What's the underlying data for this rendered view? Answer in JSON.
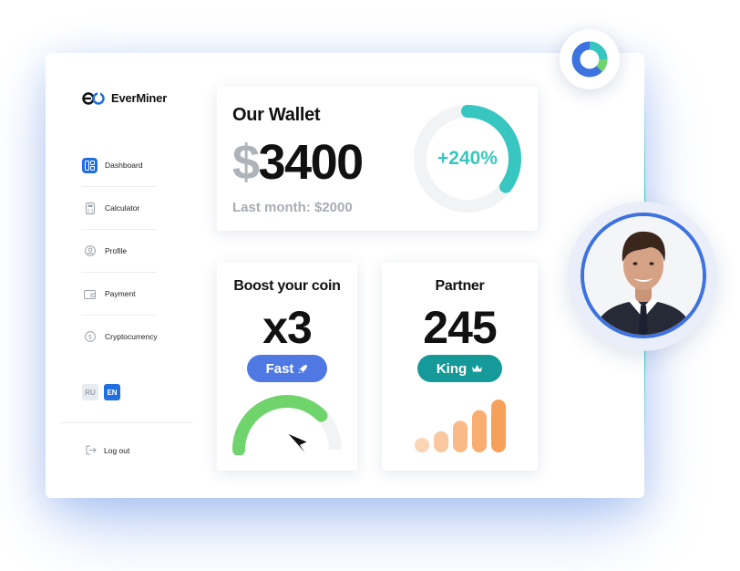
{
  "brand": {
    "name": "EverMiner"
  },
  "sidebar": {
    "items": [
      {
        "label": "Dashboard",
        "icon": "dashboard-icon",
        "active": true
      },
      {
        "label": "Calculator",
        "icon": "calculator-icon",
        "active": false
      },
      {
        "label": "Profile",
        "icon": "profile-icon",
        "active": false
      },
      {
        "label": "Payment",
        "icon": "wallet-icon",
        "active": false
      },
      {
        "label": "Cryptocurrency",
        "icon": "coin-icon",
        "active": false
      }
    ],
    "languages": [
      {
        "label": "RU",
        "active": false
      },
      {
        "label": "EN",
        "active": true
      }
    ],
    "logout_label": "Log out"
  },
  "wallet": {
    "title": "Our Wallet",
    "currency": "$",
    "amount": "3400",
    "last_month": "Last month: $2000",
    "growth": "+240%",
    "ring_fill": 0.35
  },
  "boost": {
    "title": "Boost your coin",
    "multiplier": "x3",
    "badge": "Fast",
    "badge_icon": "rocket-icon",
    "gauge_level": 0.75
  },
  "partner": {
    "title": "Partner",
    "count": "245",
    "badge": "King",
    "badge_icon": "crown-icon",
    "signal_levels": [
      1,
      2,
      3,
      4,
      5
    ]
  },
  "colors": {
    "primary": "#1f6fe0",
    "teal": "#38c6c0",
    "fast_badge": "#4f78e2",
    "king_badge": "#159a99",
    "gauge_green": "#6fd46c",
    "bar_orange": "#f7a05a"
  }
}
